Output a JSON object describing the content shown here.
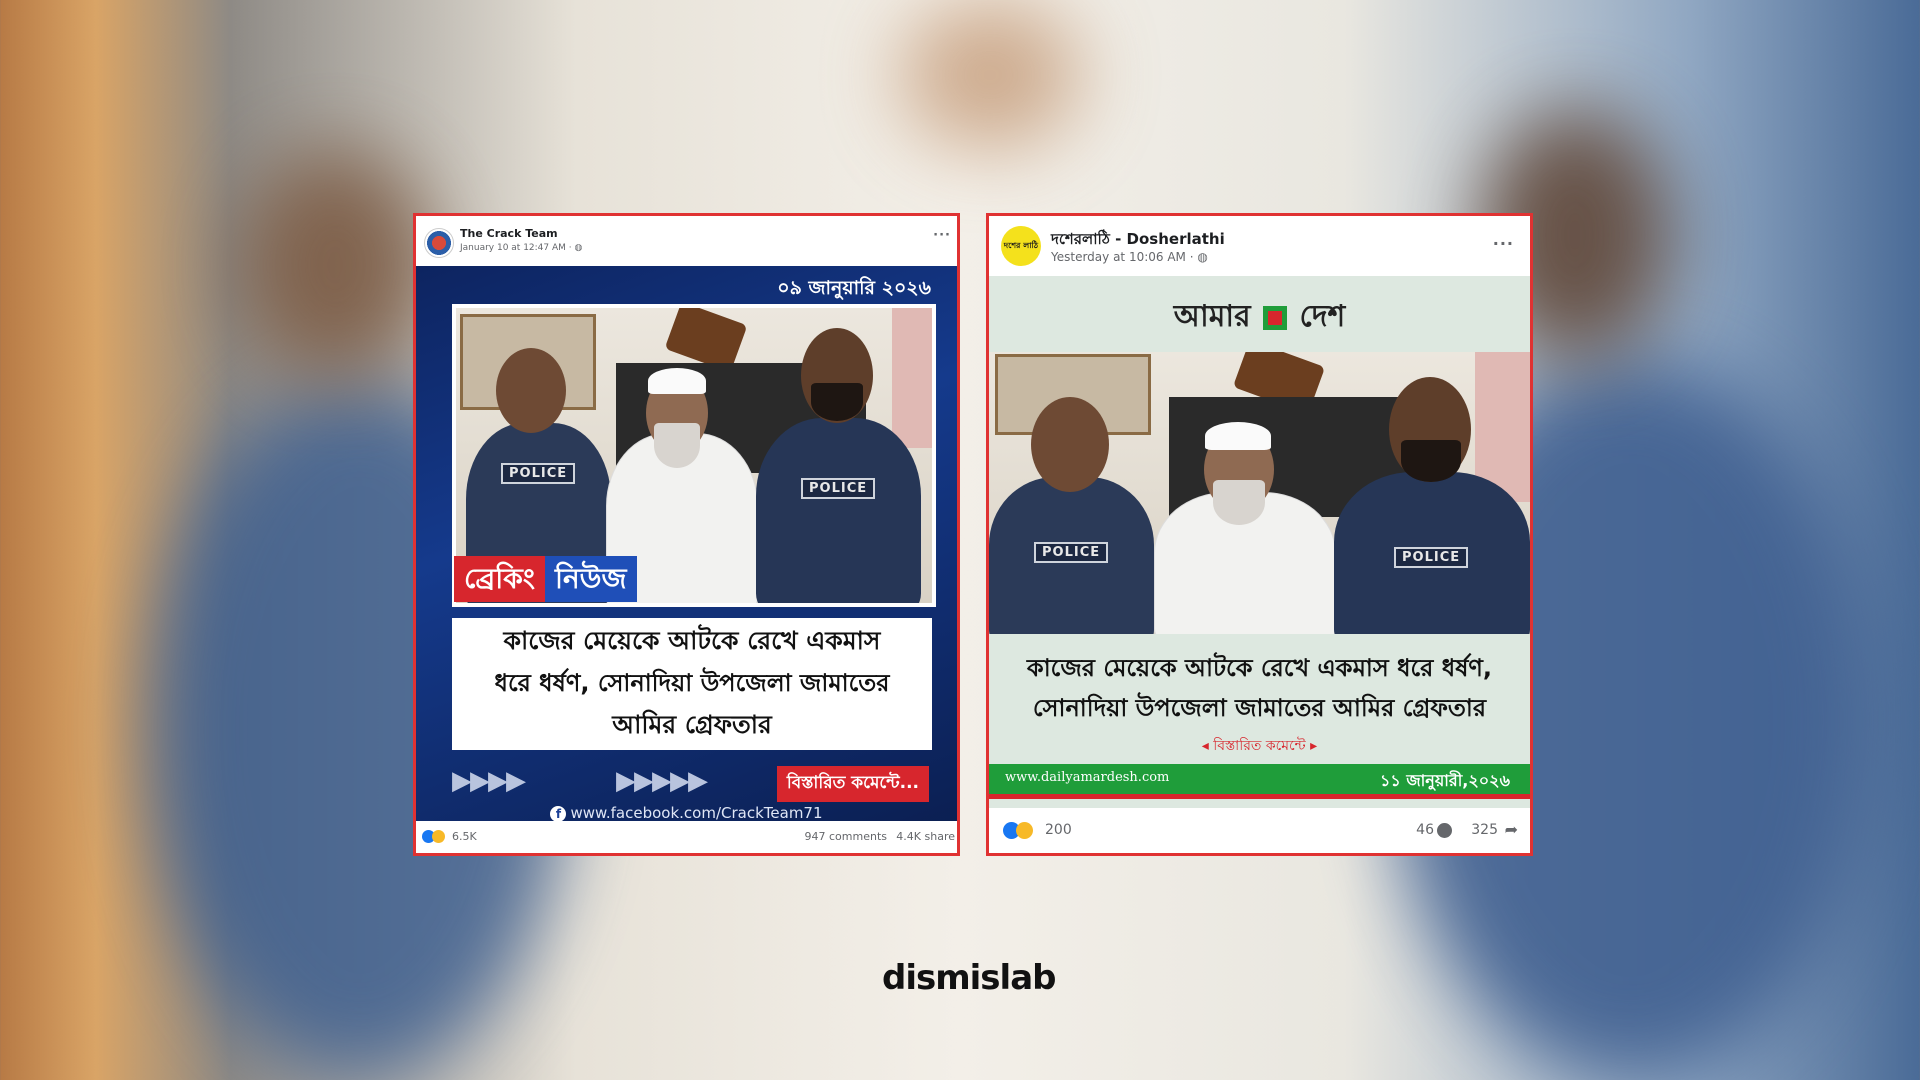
{
  "left_post": {
    "page_name": "The Crack Team",
    "timestamp": "January 10 at 12:47 AM · ",
    "date_label": "০৯ জানুয়ারি ২০২৬",
    "breaking_1": "ব্রেকিং",
    "breaking_2": "নিউজ",
    "vest_left": "POLICE",
    "vest_right": "POLICE",
    "headline_l1": "কাজের মেয়েকে আটকে রেখে একমাস",
    "headline_l2": "ধরে ধর্ষণ, সোনাদিয়া উপজেলা জামাতের",
    "headline_l3": "আমির গ্রেফতার",
    "details_button": "বিস্তারিত কমেন্টে...",
    "url": "www.facebook.com/CrackTeam71",
    "reactions_count": "6.5K",
    "comments": "947 comments",
    "shares": "4.4K share"
  },
  "right_post": {
    "page_name": "দশেরলাঠি - Dosherlathi",
    "timestamp": "Yesterday at 10:06 AM · ",
    "avatar_text": "দশের লাঠি",
    "brand_left": "আমার",
    "brand_right": "দেশ",
    "vest_left": "POLICE",
    "vest_right": "POLICE",
    "headline_l1": "কাজের মেয়েকে আটকে রেখে একমাস ধরে ধর্ষণ,",
    "headline_l2": "সোনাদিয়া উপজেলা জামাতের আমির গ্রেফতার",
    "details_link": "বিস্তারিত কমেন্টে",
    "site_url": "www.dailyamardesh.com",
    "date_label": "১১ জানুয়ারী,২০২৬",
    "reactions_count": "200",
    "comments_count": "46",
    "shares_count": "325"
  },
  "watermark": "dismislab",
  "colors": {
    "frame_red": "#e03232",
    "news_blue": "#0f2a66",
    "breaking_red": "#d7262d",
    "breaking_blue": "#1f4fb8",
    "green_bar": "#1f9d3a",
    "mint_bg": "#dde8e0"
  }
}
